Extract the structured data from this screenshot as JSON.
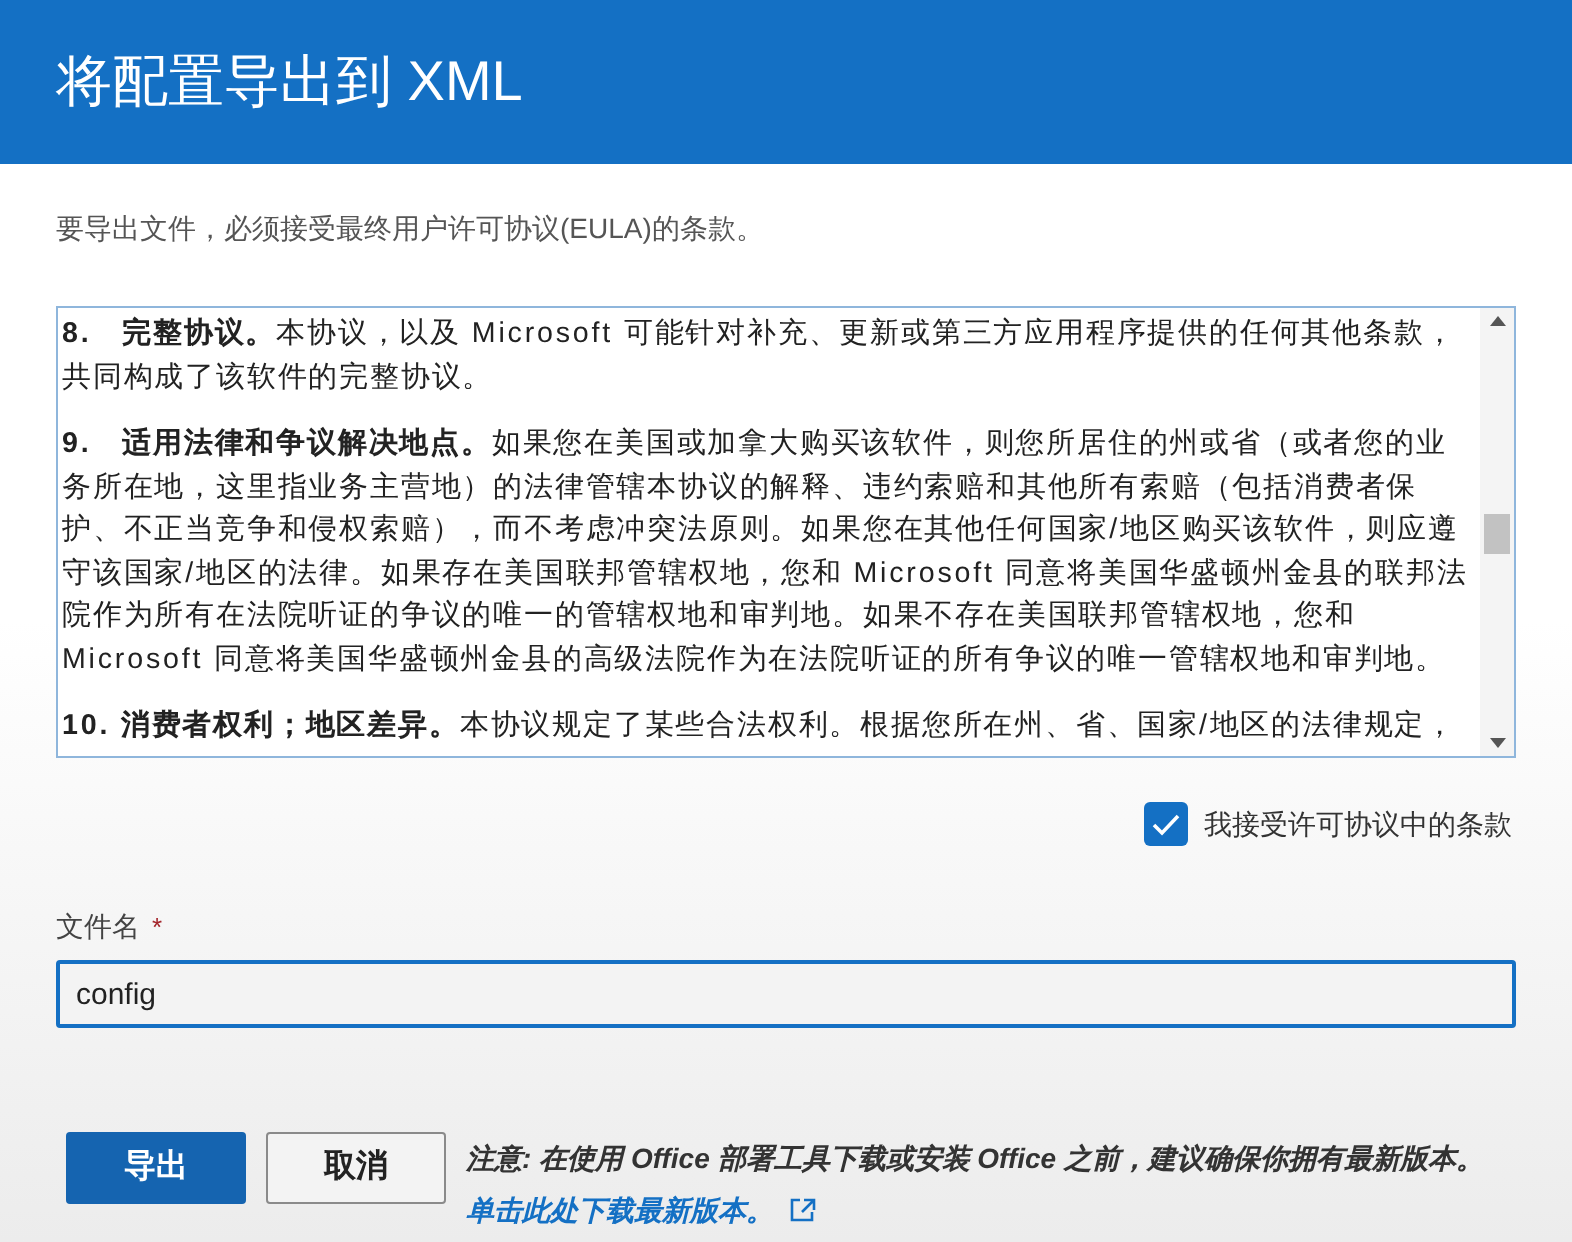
{
  "dialog": {
    "title": "将配置导出到 XML",
    "intro": "要导出文件，必须接受最终用户许可协议(EULA)的条款。",
    "eula": [
      "**8.　完整协议。**本协议，以及 Microsoft 可能针对补充、更新或第三方应用程序提供的任何其他条款，共同构成了该软件的完整协议。",
      "**9.　适用法律和争议解决地点。**如果您在美国或加拿大购买该软件，则您所居住的州或省（或者您的业务所在地，这里指业务主营地）的法律管辖本协议的解释、违约索赔和其他所有索赔（包括消费者保护、不正当竞争和侵权索赔），而不考虑冲突法原则。如果您在其他任何国家/地区购买该软件，则应遵守该国家/地区的法律。如果存在美国联邦管辖权地，您和 Microsoft 同意将美国华盛顿州金县的联邦法院作为所有在法院听证的争议的唯一的管辖权地和审判地。如果不存在美国联邦管辖权地，您和 Microsoft 同意将美国华盛顿州金县的高级法院作为在法院听证的所有争议的唯一管辖权地和审判地。",
      "**10. 消费者权利；地区差异。**本协议规定了某些合法权利。根据您所在州、省、国家/地区的法律规定，"
    ],
    "accept": {
      "label": "我接受许可协议中的条款",
      "checked": true
    },
    "filename": {
      "label": "文件名",
      "required_mark": "*",
      "value": "config"
    },
    "buttons": [
      "导出",
      "取消"
    ],
    "note": {
      "text": "注意: 在使用 Office 部署工具下载或安装 Office 之前，建议确保你拥有最新版本。",
      "link": "单击此处下载最新版本。"
    }
  }
}
